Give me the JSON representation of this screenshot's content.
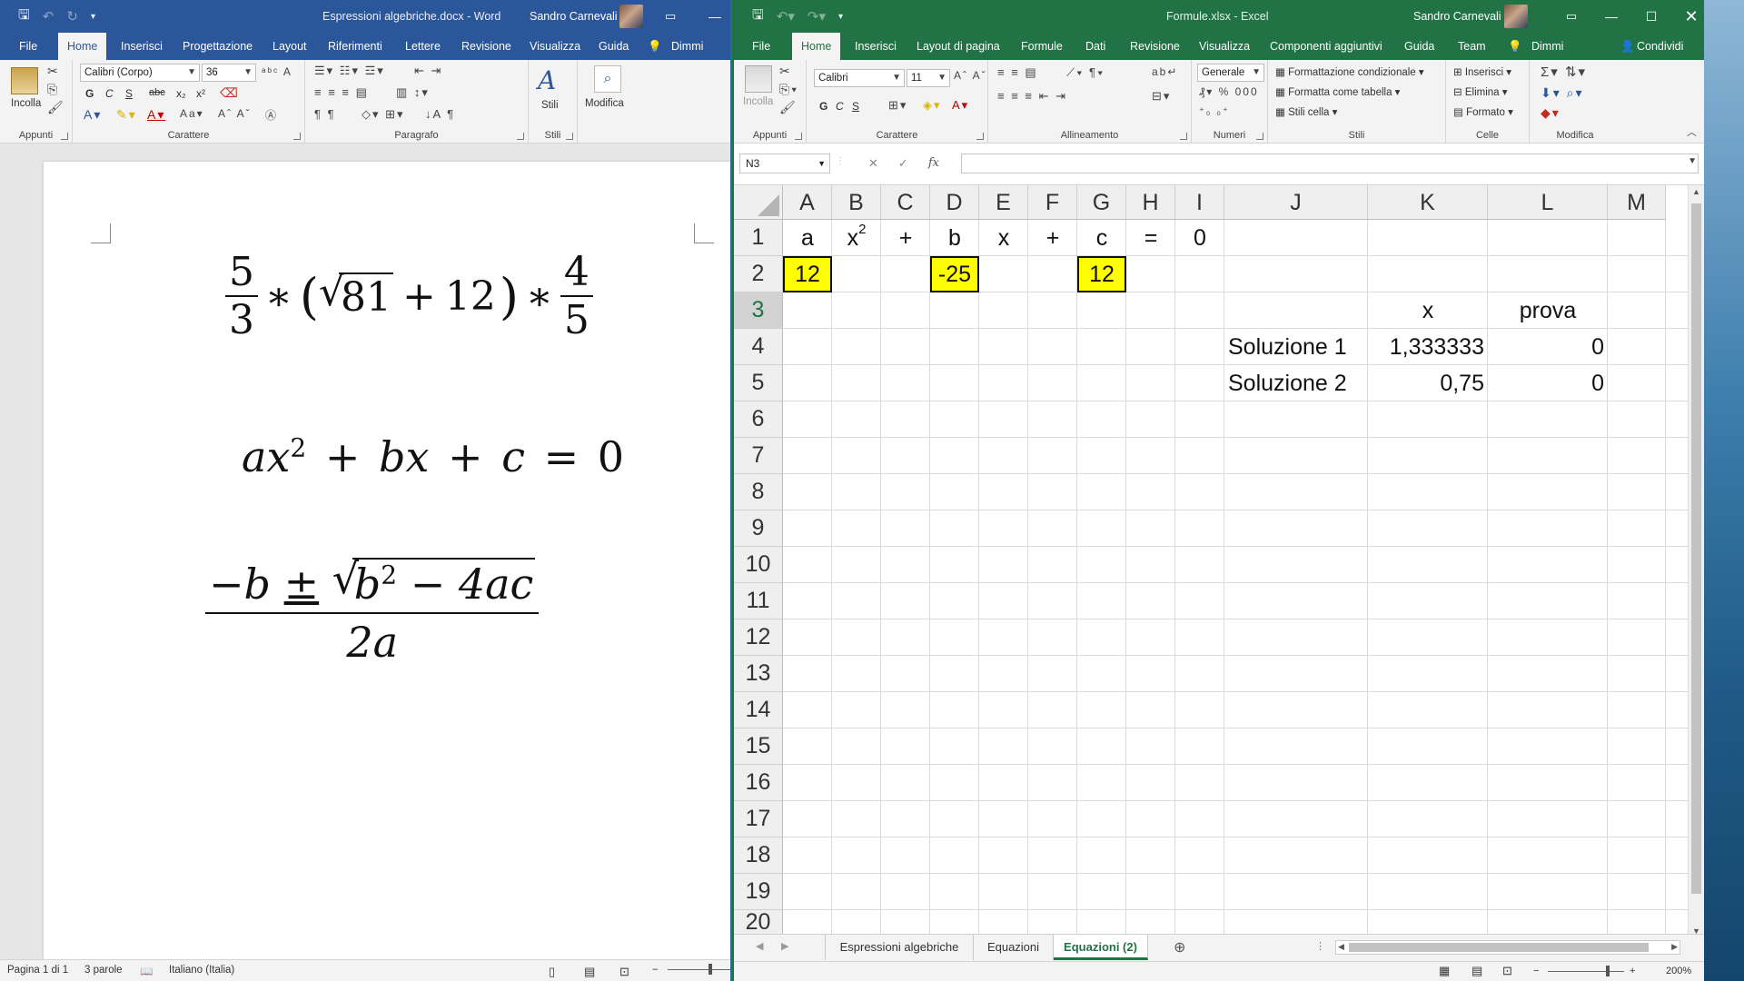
{
  "word": {
    "title": "Espressioni algebriche.docx  -  Word",
    "user": "Sandro Carnevali",
    "tabs": [
      "File",
      "Home",
      "Inserisci",
      "Progettazione",
      "Layout",
      "Riferimenti",
      "Lettere",
      "Revisione",
      "Visualizza",
      "Guida",
      "Dimmi"
    ],
    "active_tab": "Home",
    "ribbon": {
      "paste_label": "Incolla",
      "font_name": "Calibri (Corpo)",
      "font_size": "36",
      "styles_label": "Stili",
      "edit_label": "Modifica",
      "groups": [
        "Appunti",
        "Carattere",
        "Paragrafo",
        "Stili"
      ],
      "format_buttons": [
        "G",
        "C",
        "S",
        "abc",
        "x₂",
        "x²"
      ]
    },
    "equations": {
      "eq1": {
        "num1": "5",
        "den1": "3",
        "op1": "∗",
        "lparen": "(",
        "radicand": "81",
        "plus": "+",
        "twelve": "12",
        "rparen": ")",
        "op2": "∗",
        "num2": "4",
        "den2": "5"
      },
      "eq2": {
        "a": "a",
        "x": "x",
        "exp": "2",
        "plus1": "+",
        "b": "b",
        "x2": "x",
        "plus2": "+",
        "c": "c",
        "eq": "=",
        "zero": "0"
      },
      "eq3": {
        "minus_b": "−b",
        "pm": "±",
        "b": "b",
        "exp": "2",
        "minus4ac": "− 4ac",
        "den": "2a"
      }
    },
    "status": {
      "page": "Pagina 1 di 1",
      "words": "3 parole",
      "language": "Italiano (Italia)"
    }
  },
  "excel": {
    "title": "Formule.xlsx  -  Excel",
    "user": "Sandro Carnevali",
    "tabs": [
      "File",
      "Home",
      "Inserisci",
      "Layout di pagina",
      "Formule",
      "Dati",
      "Revisione",
      "Visualizza",
      "Componenti aggiuntivi",
      "Guida",
      "Team",
      "Dimmi",
      "Condividi"
    ],
    "active_tab": "Home",
    "ribbon": {
      "paste_label": "Incolla",
      "font_name": "Calibri",
      "font_size": "11",
      "number_format": "Generale",
      "format_buttons": [
        "G",
        "C",
        "S"
      ],
      "groups": [
        "Appunti",
        "Carattere",
        "Allineamento",
        "Numeri",
        "Stili",
        "Celle",
        "Modifica"
      ],
      "styles_items": [
        "Formattazione condizionale",
        "Formatta come tabella",
        "Stili cella"
      ],
      "cells_items": [
        "Inserisci",
        "Elimina",
        "Formato"
      ]
    },
    "name_box": "N3",
    "columns": [
      "A",
      "B",
      "C",
      "D",
      "E",
      "F",
      "G",
      "H",
      "I",
      "J",
      "K",
      "L",
      "M"
    ],
    "rows": [
      "1",
      "2",
      "3",
      "4",
      "5",
      "6",
      "7",
      "8",
      "9",
      "10",
      "11",
      "12",
      "13",
      "14",
      "15",
      "16",
      "17",
      "18",
      "19",
      "20"
    ],
    "cells": {
      "A1": "a",
      "B1": "x",
      "B1_sup": "2",
      "C1": "+",
      "D1": "b",
      "E1": "x",
      "F1": "+",
      "G1": "c",
      "H1": "=",
      "I1": "0",
      "A2": "12",
      "D2": "-25",
      "G2": "12",
      "K3": "x",
      "L3": "prova",
      "J4": "Soluzione 1",
      "K4": "1,333333",
      "L4": "0",
      "J5": "Soluzione 2",
      "K5": "0,75",
      "L5": "0"
    },
    "highlight_color": "#ffff00",
    "sheet_tabs": [
      "Espressioni algebriche",
      "Equazioni",
      "Equazioni (2)"
    ],
    "active_sheet": "Equazioni (2)",
    "zoom": "200%"
  }
}
